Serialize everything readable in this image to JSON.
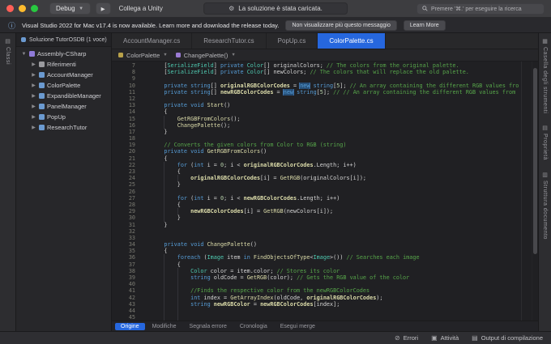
{
  "titlebar": {
    "debug_label": "Debug",
    "run_glyph": "▶",
    "attach_label": "Collega a Unity",
    "status_message": "La soluzione è stata caricata.",
    "search_placeholder": "Premere '⌘.' per eseguire la ricerca"
  },
  "notification": {
    "message": "Visual Studio 2022 for Mac v17.4 is now available. Learn more and download the release today.",
    "dismiss_label": "Non visualizzare più questo messaggio",
    "learn_more_label": "Learn More"
  },
  "left_rail": {
    "items": [
      {
        "label": "Classi",
        "icon": "▤"
      }
    ]
  },
  "right_rail": {
    "items": [
      {
        "label": "Casella degli strumenti",
        "icon": "▦"
      },
      {
        "label": "Proprietà",
        "icon": "▤"
      },
      {
        "label": "Struttura documento",
        "icon": "▥"
      }
    ]
  },
  "sidebar": {
    "header": "Soluzione TutorOSDB (1 voce)",
    "tree": [
      {
        "label": "Assembly-CSharp",
        "level": 0,
        "expanded": true,
        "icon": "#8f7ad8"
      },
      {
        "label": "Riferimenti",
        "level": 1,
        "expanded": false,
        "icon": "#9a9a9e"
      },
      {
        "label": "AccountManager",
        "level": 1,
        "expanded": false,
        "icon": "#6b9ad0"
      },
      {
        "label": "ColorPalette",
        "level": 1,
        "expanded": false,
        "icon": "#6b9ad0"
      },
      {
        "label": "ExpandibleManager",
        "level": 1,
        "expanded": false,
        "icon": "#6b9ad0"
      },
      {
        "label": "PanelManager",
        "level": 1,
        "expanded": false,
        "icon": "#6b9ad0"
      },
      {
        "label": "PopUp",
        "level": 1,
        "expanded": false,
        "icon": "#6b9ad0"
      },
      {
        "label": "ResearchTutor",
        "level": 1,
        "expanded": false,
        "icon": "#6b9ad0"
      }
    ]
  },
  "tabs": [
    {
      "label": "AccountManager.cs",
      "active": false
    },
    {
      "label": "ResearchTutor.cs",
      "active": false
    },
    {
      "label": "PopUp.cs",
      "active": false
    },
    {
      "label": "ColorPalette.cs",
      "active": true
    }
  ],
  "breadcrumb": [
    {
      "label": "ColorPalette",
      "icon": "#b8a14a"
    },
    {
      "label": "ChangePalette()",
      "icon": "#9b7bd4"
    }
  ],
  "editor": {
    "lines": [
      {
        "n": 7,
        "g": 0,
        "s": [
          [
            "p",
            "    ["
          ],
          [
            "t",
            "SerializeField"
          ],
          [
            "p",
            "] "
          ],
          [
            "k",
            "private"
          ],
          [
            "p",
            " "
          ],
          [
            "t",
            "Color"
          ],
          [
            "p",
            "[] originalColors; "
          ],
          [
            "c",
            "// The colors from the original palette."
          ]
        ]
      },
      {
        "n": 8,
        "g": 0,
        "s": [
          [
            "p",
            "    ["
          ],
          [
            "t",
            "SerializeField"
          ],
          [
            "p",
            "] "
          ],
          [
            "k",
            "private"
          ],
          [
            "p",
            " "
          ],
          [
            "t",
            "Color"
          ],
          [
            "p",
            "[] newColors; "
          ],
          [
            "c",
            "// The colors that will replace the old palette."
          ]
        ]
      },
      {
        "n": 9,
        "g": 0,
        "s": []
      },
      {
        "n": 10,
        "g": 0,
        "s": [
          [
            "p",
            "    "
          ],
          [
            "k",
            "private"
          ],
          [
            "p",
            " "
          ],
          [
            "k",
            "string"
          ],
          [
            "p",
            "[] "
          ],
          [
            "v",
            "originalRGBColorCodes"
          ],
          [
            "p",
            " = "
          ],
          [
            "h",
            "new"
          ],
          [
            "p",
            " "
          ],
          [
            "k",
            "string"
          ],
          [
            "p",
            "["
          ],
          [
            "n",
            "5"
          ],
          [
            "p",
            "]; "
          ],
          [
            "c",
            "// An array containing the different RGB values fro"
          ]
        ]
      },
      {
        "n": 11,
        "g": 0,
        "s": [
          [
            "p",
            "    "
          ],
          [
            "k",
            "private"
          ],
          [
            "p",
            " "
          ],
          [
            "k",
            "string"
          ],
          [
            "p",
            "[] "
          ],
          [
            "v",
            "newRGBColorCodes"
          ],
          [
            "p",
            " = "
          ],
          [
            "h",
            "new"
          ],
          [
            "p",
            " "
          ],
          [
            "k",
            "string"
          ],
          [
            "p",
            "["
          ],
          [
            "n",
            "5"
          ],
          [
            "p",
            "]; "
          ],
          [
            "c",
            "// // An array containing the different RGB values from"
          ]
        ]
      },
      {
        "n": 12,
        "g": 0,
        "s": []
      },
      {
        "n": 13,
        "g": 0,
        "s": [
          [
            "p",
            "    "
          ],
          [
            "k",
            "private"
          ],
          [
            "p",
            " "
          ],
          [
            "k",
            "void"
          ],
          [
            "p",
            " "
          ],
          [
            "m",
            "Start"
          ],
          [
            "p",
            "()"
          ]
        ]
      },
      {
        "n": 14,
        "g": 0,
        "s": [
          [
            "p",
            "    {"
          ]
        ]
      },
      {
        "n": 15,
        "g": 1,
        "s": [
          [
            "p",
            "        "
          ],
          [
            "m",
            "GetRGBFromColors"
          ],
          [
            "p",
            "();"
          ]
        ]
      },
      {
        "n": 16,
        "g": 1,
        "s": [
          [
            "p",
            "        "
          ],
          [
            "m",
            "ChangePalette"
          ],
          [
            "p",
            "();"
          ]
        ]
      },
      {
        "n": 17,
        "g": 0,
        "s": [
          [
            "p",
            "    }"
          ]
        ]
      },
      {
        "n": 18,
        "g": 0,
        "s": []
      },
      {
        "n": 19,
        "g": 0,
        "s": [
          [
            "c",
            "    // Converts the given colors from Color to RGB (string)"
          ]
        ]
      },
      {
        "n": 20,
        "g": 0,
        "s": [
          [
            "p",
            "    "
          ],
          [
            "k",
            "private"
          ],
          [
            "p",
            " "
          ],
          [
            "k",
            "void"
          ],
          [
            "p",
            " "
          ],
          [
            "m",
            "GetRGBFromColors"
          ],
          [
            "p",
            "()"
          ]
        ]
      },
      {
        "n": 21,
        "g": 0,
        "s": [
          [
            "p",
            "    {"
          ]
        ]
      },
      {
        "n": 22,
        "g": 1,
        "s": [
          [
            "p",
            "        "
          ],
          [
            "k",
            "for"
          ],
          [
            "p",
            " ("
          ],
          [
            "k",
            "int"
          ],
          [
            "p",
            " i = "
          ],
          [
            "n",
            "0"
          ],
          [
            "p",
            "; i < "
          ],
          [
            "v",
            "originalRGBColorCodes"
          ],
          [
            "p",
            ".Length; i++)"
          ]
        ]
      },
      {
        "n": 23,
        "g": 1,
        "s": [
          [
            "p",
            "        {"
          ]
        ]
      },
      {
        "n": 24,
        "g": 2,
        "s": [
          [
            "p",
            "            "
          ],
          [
            "v",
            "originalRGBColorCodes"
          ],
          [
            "p",
            "[i] = "
          ],
          [
            "m",
            "GetRGB"
          ],
          [
            "p",
            "(originalColors[i]);"
          ]
        ]
      },
      {
        "n": 25,
        "g": 1,
        "s": [
          [
            "p",
            "        }"
          ]
        ]
      },
      {
        "n": 26,
        "g": 1,
        "s": []
      },
      {
        "n": 27,
        "g": 1,
        "s": [
          [
            "p",
            "        "
          ],
          [
            "k",
            "for"
          ],
          [
            "p",
            " ("
          ],
          [
            "k",
            "int"
          ],
          [
            "p",
            " i = "
          ],
          [
            "n",
            "0"
          ],
          [
            "p",
            "; i < "
          ],
          [
            "v",
            "newRGBColorCodes"
          ],
          [
            "p",
            ".Length; i++)"
          ]
        ]
      },
      {
        "n": 28,
        "g": 1,
        "s": [
          [
            "p",
            "        {"
          ]
        ]
      },
      {
        "n": 29,
        "g": 2,
        "s": [
          [
            "p",
            "            "
          ],
          [
            "v",
            "newRGBColorCodes"
          ],
          [
            "p",
            "[i] = "
          ],
          [
            "m",
            "GetRGB"
          ],
          [
            "p",
            "(newColors[i]);"
          ]
        ]
      },
      {
        "n": 30,
        "g": 1,
        "s": [
          [
            "p",
            "        }"
          ]
        ]
      },
      {
        "n": 31,
        "g": 0,
        "s": [
          [
            "p",
            "    }"
          ]
        ]
      },
      {
        "n": 32,
        "g": 0,
        "s": []
      },
      {
        "n": 33,
        "g": 0,
        "s": []
      },
      {
        "n": 34,
        "g": 0,
        "s": [
          [
            "p",
            "    "
          ],
          [
            "k",
            "private"
          ],
          [
            "p",
            " "
          ],
          [
            "k",
            "void"
          ],
          [
            "p",
            " "
          ],
          [
            "m",
            "ChangePalette"
          ],
          [
            "p",
            "()"
          ]
        ]
      },
      {
        "n": 35,
        "g": 0,
        "s": [
          [
            "p",
            "    {"
          ]
        ]
      },
      {
        "n": 36,
        "g": 1,
        "s": [
          [
            "p",
            "        "
          ],
          [
            "k",
            "foreach"
          ],
          [
            "p",
            " ("
          ],
          [
            "t",
            "Image"
          ],
          [
            "p",
            " item "
          ],
          [
            "k",
            "in"
          ],
          [
            "p",
            " "
          ],
          [
            "m",
            "FindObjectsOfType"
          ],
          [
            "p",
            "<"
          ],
          [
            "t",
            "Image"
          ],
          [
            "p",
            ">()) "
          ],
          [
            "c",
            "// Searches each image"
          ]
        ]
      },
      {
        "n": 37,
        "g": 1,
        "s": [
          [
            "p",
            "        {"
          ]
        ]
      },
      {
        "n": 38,
        "g": 2,
        "s": [
          [
            "p",
            "            "
          ],
          [
            "t",
            "Color"
          ],
          [
            "p",
            " color = item.color; "
          ],
          [
            "c",
            "// Stores its color"
          ]
        ]
      },
      {
        "n": 39,
        "g": 2,
        "s": [
          [
            "p",
            "            "
          ],
          [
            "k",
            "string"
          ],
          [
            "p",
            " oldCode = "
          ],
          [
            "m",
            "GetRGB"
          ],
          [
            "p",
            "(color); "
          ],
          [
            "c",
            "// Gets the RGB value of the color"
          ]
        ]
      },
      {
        "n": 40,
        "g": 2,
        "s": []
      },
      {
        "n": 41,
        "g": 2,
        "s": [
          [
            "c",
            "            //Finds the respective color from the newRGBColorCodes"
          ]
        ]
      },
      {
        "n": 42,
        "g": 2,
        "s": [
          [
            "p",
            "            "
          ],
          [
            "k",
            "int"
          ],
          [
            "p",
            " index = "
          ],
          [
            "m",
            "GetArrayIndex"
          ],
          [
            "p",
            "(oldCode, "
          ],
          [
            "v",
            "originalRGBColorCodes"
          ],
          [
            "p",
            ");"
          ]
        ]
      },
      {
        "n": 43,
        "g": 2,
        "s": [
          [
            "p",
            "            "
          ],
          [
            "k",
            "string"
          ],
          [
            "p",
            " "
          ],
          [
            "v",
            "newRGBColor"
          ],
          [
            "p",
            " = "
          ],
          [
            "v",
            "newRGBColorCodes"
          ],
          [
            "p",
            "[index];"
          ]
        ]
      },
      {
        "n": 44,
        "g": 2,
        "s": []
      },
      {
        "n": 45,
        "g": 2,
        "s": []
      }
    ]
  },
  "bottom_tabs": [
    {
      "label": "Origine",
      "active": true
    },
    {
      "label": "Modifiche",
      "active": false
    },
    {
      "label": "Segnala errore",
      "active": false
    },
    {
      "label": "Cronologia",
      "active": false
    },
    {
      "label": "Esegui merge",
      "active": false
    }
  ],
  "statusbar": {
    "items": [
      {
        "label": "Errori",
        "icon": "⊘"
      },
      {
        "label": "Attività",
        "icon": "▣"
      },
      {
        "label": "Output di compilazione",
        "icon": "▤"
      }
    ]
  },
  "colors": {
    "accent": "#2667de",
    "editor_bg": "#202023",
    "titlebar_bg": "#3d3d40"
  }
}
